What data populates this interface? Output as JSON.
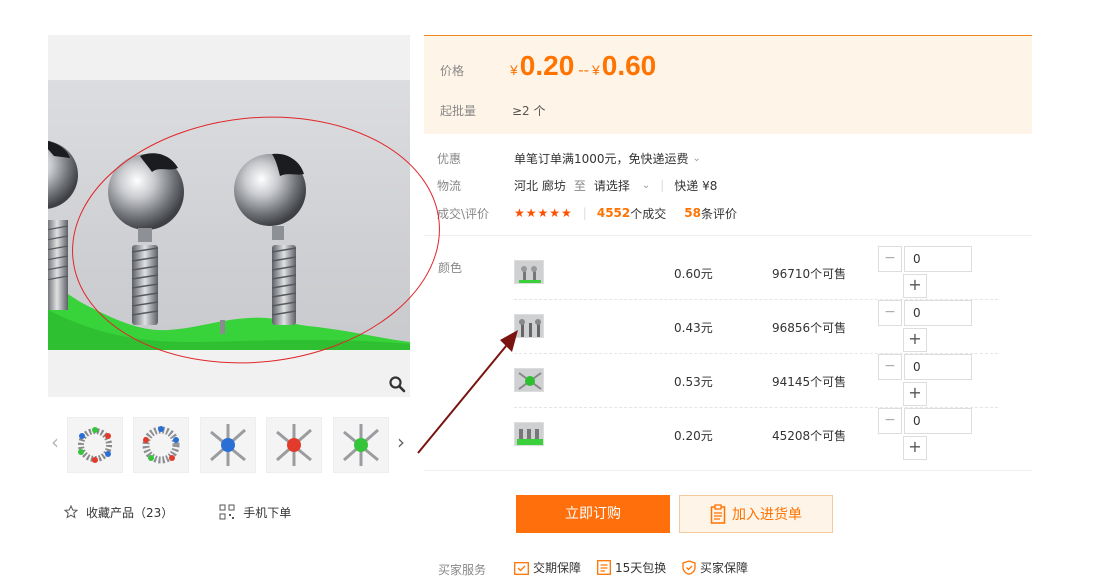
{
  "gallery": {
    "thumb_nav_prev": "‹",
    "thumb_nav_next": "›",
    "thumbnails": [
      "thumb-1",
      "thumb-2",
      "thumb-3",
      "thumb-4",
      "thumb-5"
    ],
    "favorite_label": "收藏产品（23）",
    "mobile_order_label": "手机下单",
    "icons": {
      "zoom": "search-icon",
      "favorite": "star-icon",
      "mobile": "qrcode-icon"
    }
  },
  "price": {
    "label": "价格",
    "currency": "¥",
    "low": "0.20",
    "separator": "--",
    "high": "0.60",
    "moq_label": "起批量",
    "moq_value": "≥2 个"
  },
  "info": {
    "promo_label": "优惠",
    "promo_text": "单笔订单满1000元，免快递运费",
    "shipping_label": "物流",
    "origin": "河北 廊坊",
    "to_label": "至",
    "destination": "请选择",
    "express": "快递 ¥8",
    "review_label": "成交\\评价",
    "stars": "★★★★★",
    "deals_count": "4552",
    "deals_suffix": "个成交",
    "reviews_count": "58",
    "reviews_suffix": "条评价"
  },
  "skus": {
    "label": "颜色",
    "items": [
      {
        "price": "0.60元",
        "stock": "96710个可售",
        "qty": "0"
      },
      {
        "price": "0.43元",
        "stock": "96856个可售",
        "qty": "0"
      },
      {
        "price": "0.53元",
        "stock": "94145个可售",
        "qty": "0"
      },
      {
        "price": "0.20元",
        "stock": "45208个可售",
        "qty": "0"
      }
    ],
    "minus": "−",
    "plus": "+"
  },
  "actions": {
    "buy_label": "立即订购",
    "cart_label": "加入进货单"
  },
  "services": {
    "label": "买家服务",
    "items": [
      "交期保障",
      "15天包换",
      "买家保障"
    ]
  },
  "colors": {
    "accent": "#ff7300",
    "price_bg": "#fff4e8",
    "annotation_red": "#e0262a",
    "arrow": "#7a1410"
  }
}
